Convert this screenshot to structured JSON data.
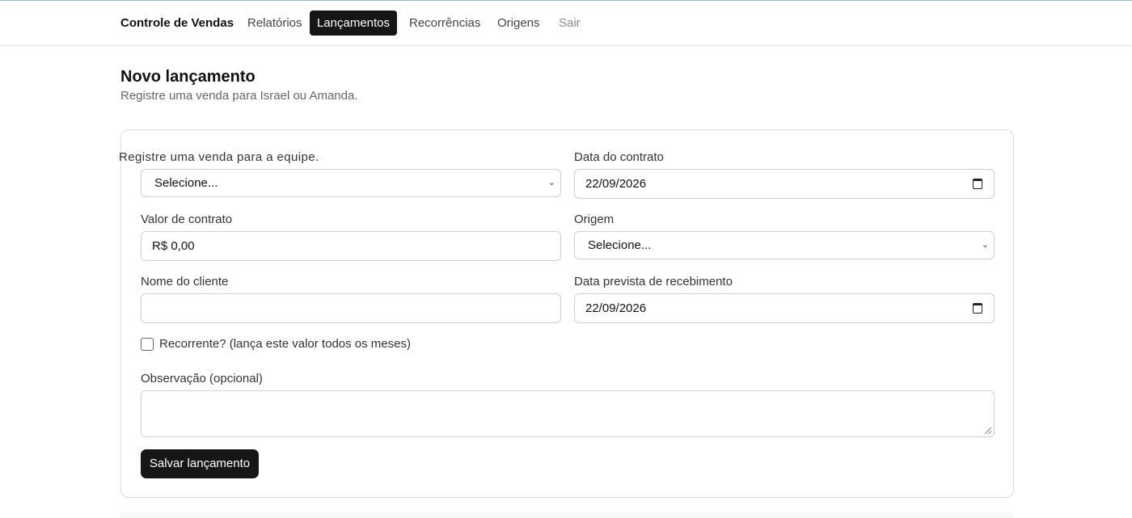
{
  "nav": {
    "brand": "Controle de Vendas",
    "items": [
      "Relatórios",
      "Lançamentos",
      "Recorrências",
      "Origens",
      "Sair"
    ],
    "active": "Lançamentos"
  },
  "header": {
    "title": "Novo lançamento",
    "subtitle": "Registre uma venda para Israel ou Amanda."
  },
  "form": {
    "seller_label": "Registre uma venda para a equipe.",
    "seller_value": "Selecione...",
    "contract_date_label": "Data do contrato",
    "contract_date_value": "22/09/2026",
    "contract_value_label": "Valor de contrato",
    "contract_value_value": "R$ 0,00",
    "origin_label": "Origem",
    "origin_value": "Selecione...",
    "client_name_label": "Nome do cliente",
    "client_name_value": "",
    "expected_date_label": "Data prevista de recebimento",
    "expected_date_value": "22/09/2026",
    "recurring_label": "Recorrente? (lança este valor todos os meses)",
    "recurring_checked": false,
    "note_label": "Observação (opcional)",
    "note_value": "",
    "submit_label": "Salvar lançamento"
  },
  "colors": {
    "primary": "#161616",
    "border": "#cfcfcf",
    "muted_text": "#666666"
  },
  "icons": {
    "select": "chevron-down-icon",
    "date": "calendar-icon",
    "resize": "resize-grip-icon"
  }
}
